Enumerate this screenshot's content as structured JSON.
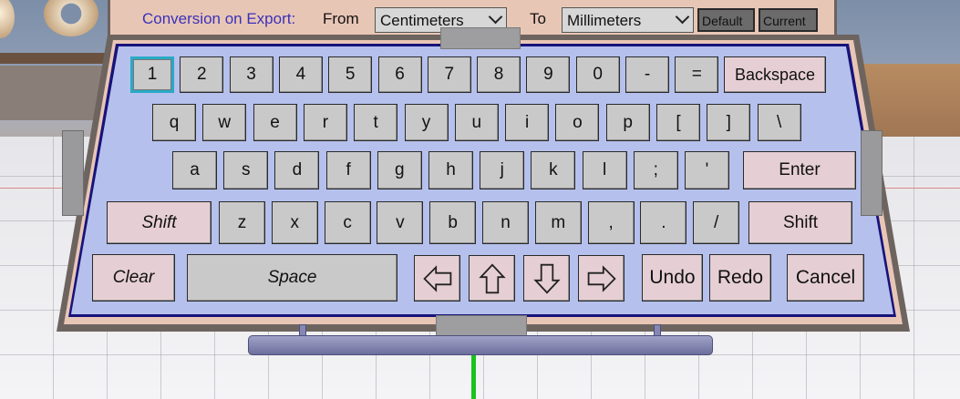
{
  "conversion": {
    "title": "Conversion on Export:",
    "from_label": "From",
    "from_value": "Centimeters",
    "to_label": "To",
    "to_value": "Millimeters",
    "default_label": "Default",
    "current_label": "Current"
  },
  "keyboard": {
    "row1": [
      "1",
      "2",
      "3",
      "4",
      "5",
      "6",
      "7",
      "8",
      "9",
      "0",
      "-",
      "=",
      "Backspace"
    ],
    "row2": [
      "q",
      "w",
      "e",
      "r",
      "t",
      "y",
      "u",
      "i",
      "o",
      "p",
      "[",
      "]",
      "\\"
    ],
    "row3": [
      "a",
      "s",
      "d",
      "f",
      "g",
      "h",
      "j",
      "k",
      "l",
      ";",
      "'",
      "Enter"
    ],
    "row4": [
      "Shift",
      "z",
      "x",
      "c",
      "v",
      "b",
      "n",
      "m",
      ",",
      ".",
      "/",
      "Shift"
    ],
    "row5": {
      "clear": "Clear",
      "space": "Space",
      "arrow_left": "left-arrow-icon",
      "arrow_up": "up-arrow-icon",
      "arrow_down": "down-arrow-icon",
      "arrow_right": "right-arrow-icon",
      "undo": "Undo",
      "redo": "Redo",
      "cancel": "Cancel"
    },
    "focused_key": "1"
  },
  "colors": {
    "keyboard_face": "#b5c0ec",
    "key_gray": "#c9c9c9",
    "key_pink": "#e6cfd4",
    "focus_outline": "#29a9c5",
    "panel_bg": "#e8c6b6",
    "title_blue": "#3b31b8"
  }
}
